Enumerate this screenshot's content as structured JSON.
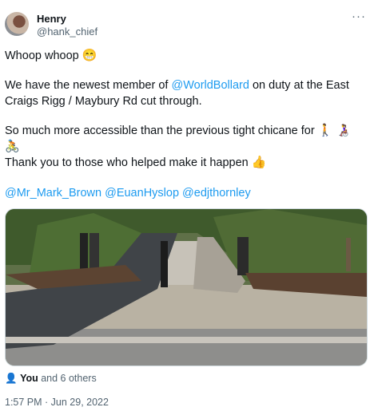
{
  "author": {
    "display_name": "Henry",
    "handle": "@hank_chief"
  },
  "tweet": {
    "line1": "Whoop whoop",
    "line1_emoji": "😁",
    "p2_prefix": "We have the newest member of ",
    "p2_mention": "@WorldBollard",
    "p2_suffix": " on duty at the East Craigs Rigg / Maybury Rd cut through.",
    "p3": "So much more accessible than the previous tight chicane for ",
    "p3_emoji": "🚶 👩‍🦽 🚴",
    "p4": "Thank you to those who helped make it happen",
    "p4_emoji": "👍",
    "mentions": "@Mr_Mark_Brown @EuanHyslop @edjthornley"
  },
  "likes": {
    "icon": "person-icon",
    "you": "You",
    "rest": " and 6 others"
  },
  "timestamp": "1:57 PM · Jun 29, 2022",
  "colors": {
    "link": "#1d9bf0",
    "secondary_text": "#536471",
    "primary_text": "#0f1419"
  }
}
